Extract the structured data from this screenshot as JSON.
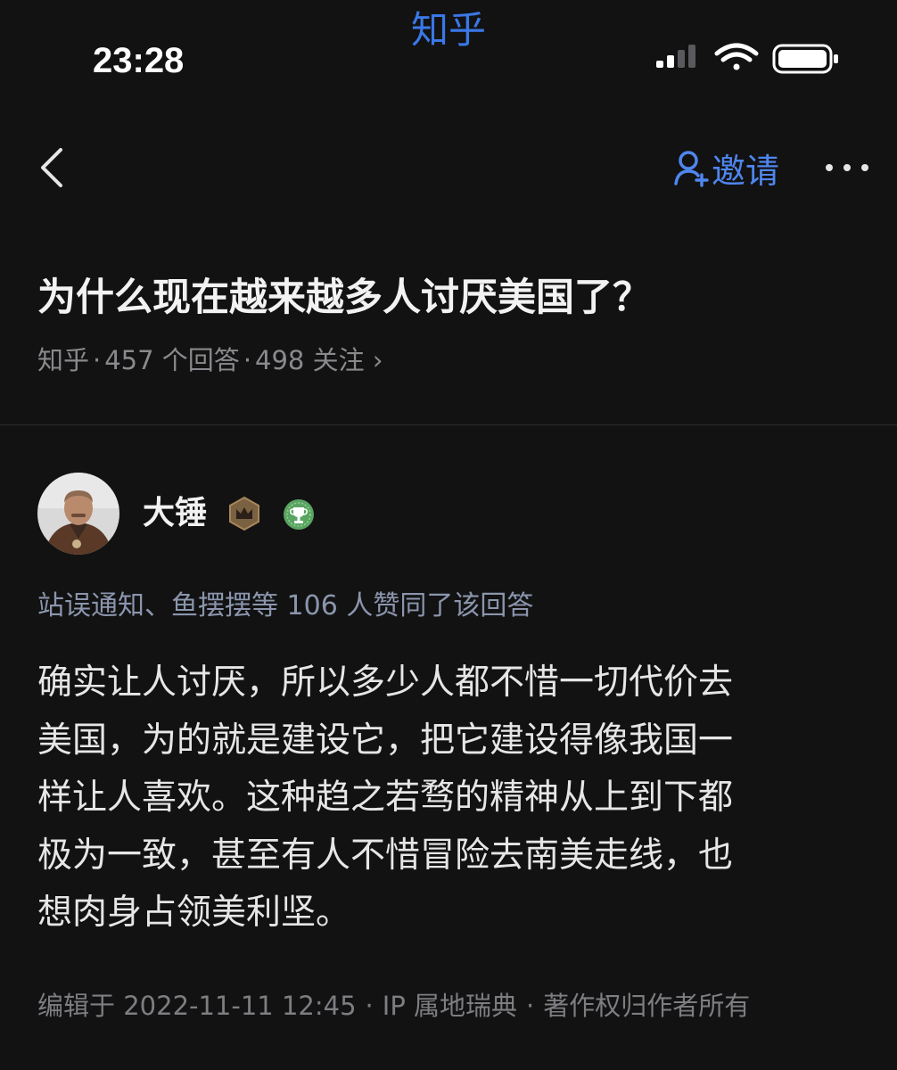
{
  "status_bar": {
    "app_name": "知乎",
    "time": "23:28",
    "icons": [
      "cellular-signal-icon",
      "wifi-icon",
      "battery-icon"
    ]
  },
  "nav": {
    "invite_label": "邀请",
    "icons": [
      "back-icon",
      "invite-person-icon",
      "more-icon"
    ]
  },
  "question": {
    "title": "为什么现在越来越多人讨厌美国了？",
    "source": "知乎",
    "answers": "457 个回答",
    "followers": "498 关注",
    "chevron": "›"
  },
  "answer": {
    "author": "大锤",
    "badges": [
      "crown-badge-icon",
      "trophy-badge-icon"
    ],
    "upvote_summary": "站误通知、鱼摆摆等 106 人赞同了该回答",
    "body_lines": [
      "确实让人讨厌，所以多少人都不惜一切代价去",
      "美国，为的就是建设它，把它建设得像我国一",
      "样让人喜欢。这种趋之若骛的精神从上到下都",
      "极为一致，甚至有人不惜冒险去南美走线，也",
      "想肉身占领美利坚。"
    ],
    "edited": "编辑于 2022-11-11 12:45",
    "ip_location": "IP 属地瑞典",
    "copyright": "著作权归作者所有"
  },
  "colors": {
    "background": "#121212",
    "brand_blue": "#3a78e8",
    "link_blue": "#4f86ee",
    "secondary_text": "#8a8a8e"
  }
}
